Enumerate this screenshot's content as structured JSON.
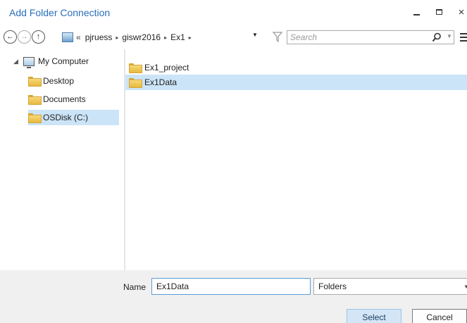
{
  "window": {
    "title": "Add Folder Connection",
    "controls": {
      "minimize": "‗",
      "maximize": "□",
      "close": "×"
    }
  },
  "toolbar": {
    "back_glyph": "←",
    "forward_glyph": "→",
    "up_glyph": "↑",
    "breadcrumb_overflow": "«",
    "breadcrumbs": [
      "pjruess",
      "giswr2016",
      "Ex1"
    ],
    "breadcrumb_separator": "▸",
    "address_dropdown_glyph": "▼",
    "search": {
      "placeholder": "Search",
      "value": ""
    },
    "search_dropdown_glyph": "▼"
  },
  "nav_tree": {
    "root": {
      "label": "My Computer",
      "expander": "◢",
      "icon": "computer-icon"
    },
    "items": [
      {
        "label": "Desktop",
        "icon": "folder-icon",
        "selected": false
      },
      {
        "label": "Documents",
        "icon": "folder-icon",
        "selected": false
      },
      {
        "label": "OSDisk (C:)",
        "icon": "folder-icon",
        "selected": true
      }
    ]
  },
  "content": {
    "items": [
      {
        "label": "Ex1_project",
        "icon": "folder-icon",
        "selected": false
      },
      {
        "label": "Ex1Data",
        "icon": "folder-icon",
        "selected": true
      }
    ]
  },
  "footer": {
    "name_label": "Name",
    "name_value": "Ex1Data",
    "filetype_value": "Folders",
    "filetype_caret": "▼",
    "select_label": "Select",
    "cancel_label": "Cancel"
  },
  "colors": {
    "title": "#2a6ebd",
    "selection": "#cce4f7",
    "footer_bg": "#f0f0f0",
    "input_focus_border": "#5b9bd5",
    "primary_button_bg": "#d4e6f6"
  }
}
